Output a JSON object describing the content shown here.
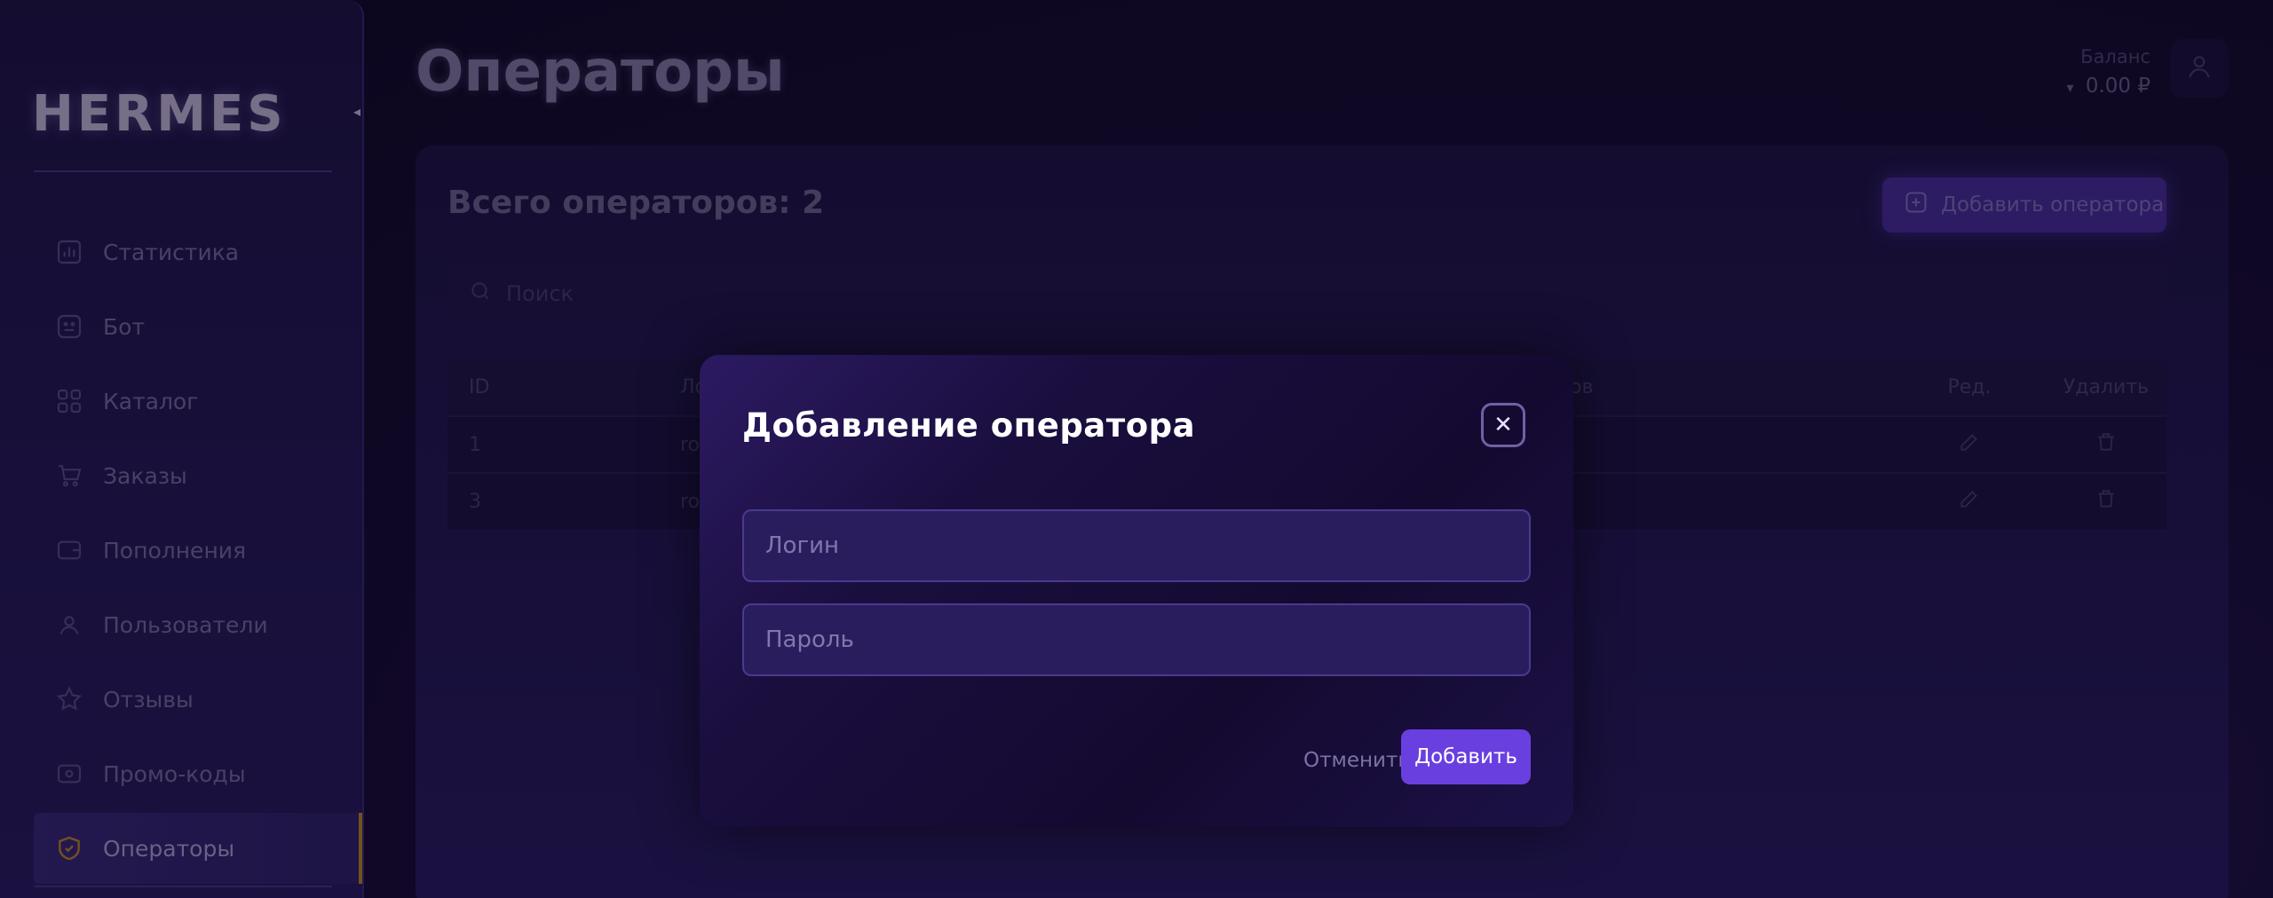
{
  "app": {
    "logo": "HERMES",
    "page_title": "Операторы"
  },
  "sidebar": {
    "items": [
      {
        "label": "Статистика",
        "icon": "bar-chart-icon"
      },
      {
        "label": "Бот",
        "icon": "bot-icon"
      },
      {
        "label": "Каталог",
        "icon": "grid-icon"
      },
      {
        "label": "Заказы",
        "icon": "cart-icon"
      },
      {
        "label": "Пополнения",
        "icon": "wallet-icon"
      },
      {
        "label": "Пользователи",
        "icon": "users-icon"
      },
      {
        "label": "Отзывы",
        "icon": "star-icon"
      },
      {
        "label": "Промо-коды",
        "icon": "ticket-icon"
      },
      {
        "label": "Операторы",
        "icon": "shield-icon",
        "active": true
      }
    ]
  },
  "header": {
    "balance_label": "Баланс",
    "balance_value": "0.00 ₽",
    "balance_caret": "▾"
  },
  "main": {
    "total_label": "Всего операторов: 2",
    "add_button": "Добавить оператора",
    "search_placeholder": "Поиск",
    "table": {
      "headers": {
        "id": "ID",
        "login": "Ло",
        "orders": "ов",
        "edit": "Ред.",
        "delete": "Удалить"
      },
      "rows": [
        {
          "id": "1",
          "login": "ro"
        },
        {
          "id": "3",
          "login": "ro"
        }
      ]
    }
  },
  "modal": {
    "title": "Добавление оператора",
    "close_glyph": "✕",
    "login_placeholder": "Логин",
    "password_placeholder": "Пароль",
    "cancel_label": "Отменить",
    "submit_label": "Добавить"
  },
  "colors": {
    "accent": "#6a3fe0",
    "active_marker": "#c8902a",
    "background": "#0d0820"
  }
}
